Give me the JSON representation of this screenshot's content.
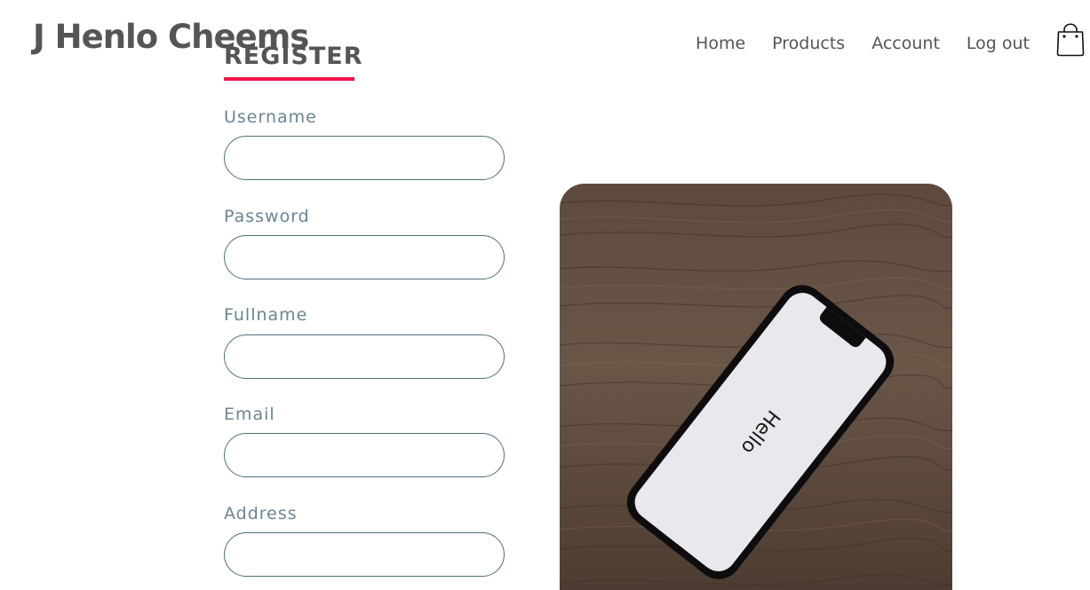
{
  "header": {
    "brand": "J Henlo Cheems",
    "nav": [
      "Home",
      "Products",
      "Account",
      "Log out"
    ],
    "cart_icon": "shopping-bag-icon"
  },
  "form": {
    "title": "REGISTER",
    "accent_color": "#f0134d",
    "fields": [
      {
        "label": "Username",
        "value": ""
      },
      {
        "label": "Password",
        "value": ""
      },
      {
        "label": "Fullname",
        "value": ""
      },
      {
        "label": "Email",
        "value": ""
      },
      {
        "label": "Address",
        "value": ""
      }
    ]
  },
  "photo": {
    "screen_text": "Hello"
  }
}
